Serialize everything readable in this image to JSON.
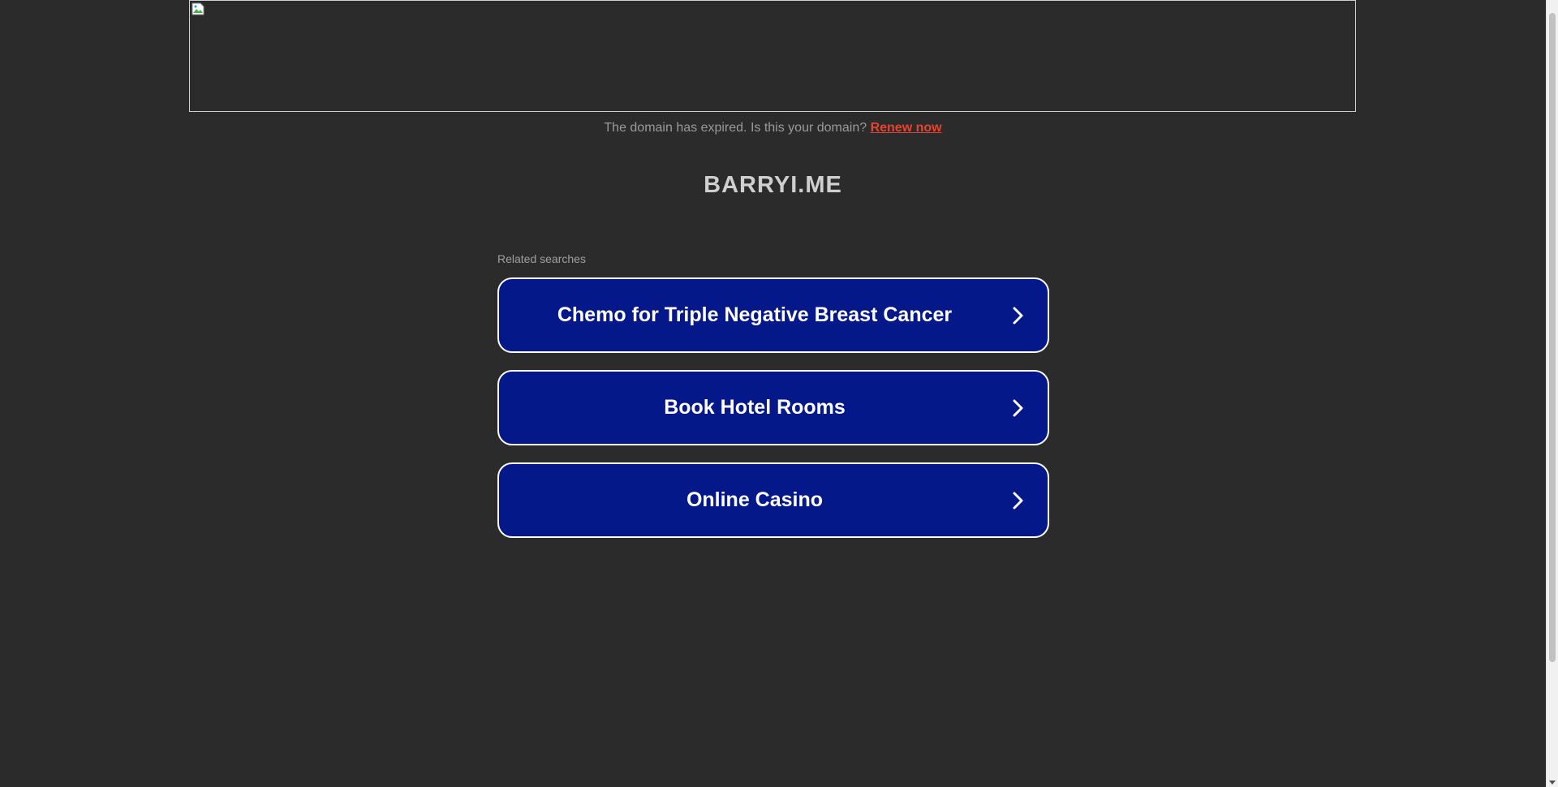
{
  "banner": {
    "icon": "broken-image-icon"
  },
  "notice": {
    "text": "The domain has expired. Is this your domain?",
    "link_label": "Renew now"
  },
  "domain": {
    "name": "BARRYI.ME"
  },
  "related": {
    "label": "Related searches",
    "items": [
      {
        "label": "Chemo for Triple Negative Breast Cancer",
        "icon": "chevron-right-icon"
      },
      {
        "label": "Book Hotel Rooms",
        "icon": "chevron-right-icon"
      },
      {
        "label": "Online Casino",
        "icon": "chevron-right-icon"
      }
    ]
  },
  "colors": {
    "background": "#2b2b2b",
    "button": "#04188a",
    "link": "#e8432e"
  }
}
